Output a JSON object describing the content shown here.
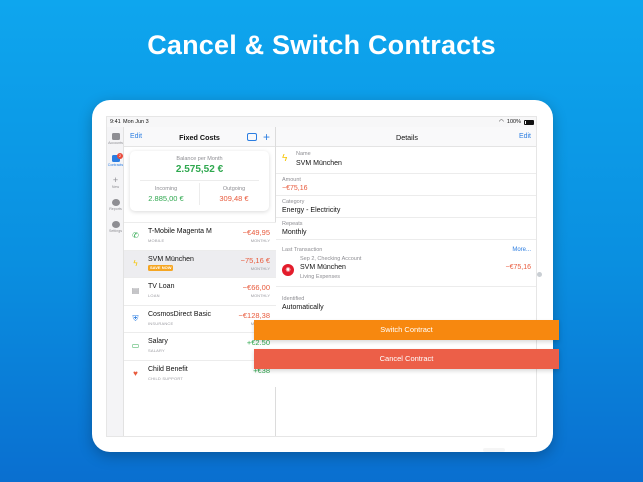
{
  "headline": "Cancel & Switch Contracts",
  "status_bar": {
    "time": "9:41",
    "date": "Mon Jun 3",
    "battery": "100%"
  },
  "rail": {
    "items": [
      {
        "label": "Accounts",
        "icon": "card-icon"
      },
      {
        "label": "Contracts",
        "icon": "contracts-icon",
        "badge": "2"
      },
      {
        "label": "New",
        "icon": "plus-icon"
      },
      {
        "label": "Reports",
        "icon": "pie-chart-icon"
      },
      {
        "label": "Settings",
        "icon": "gear-icon"
      }
    ]
  },
  "master": {
    "edit_label": "Edit",
    "title": "Fixed Costs",
    "balance": {
      "label": "Balance per Month",
      "value": "2.575,52 €",
      "incoming_label": "Incoming",
      "incoming_value": "2.885,00 €",
      "outgoing_label": "Outgoing",
      "outgoing_value": "309,48 €"
    },
    "rows": [
      {
        "name": "T-Mobile Magenta M",
        "sub": "MOBILE",
        "amount": "−€49,95",
        "freq": "MONTHLY",
        "icon": "phone-icon",
        "sign": "neg"
      },
      {
        "name": "SVM München",
        "badge": "SAVE NOW",
        "amount": "−75,16 €",
        "freq": "MONTHLY",
        "icon": "bolt-icon",
        "sign": "neg"
      },
      {
        "name": "TV Loan",
        "sub": "LOAN",
        "amount": "−€66,00",
        "freq": "MONTHLY",
        "icon": "document-icon",
        "sign": "neg"
      },
      {
        "name": "CosmosDirect Basic",
        "sub": "INSURANCE",
        "amount": "−€128,38",
        "freq": "MONTHLY",
        "icon": "shield-icon",
        "sign": "neg"
      },
      {
        "name": "Salary",
        "sub": "SALARY",
        "amount": "+€2.50",
        "freq": "M",
        "icon": "money-icon",
        "sign": "pos"
      },
      {
        "name": "Child Benefit",
        "sub": "CHILD SUPPORT",
        "amount": "+€38",
        "freq": "",
        "icon": "heart-icon",
        "sign": "pos"
      }
    ]
  },
  "detail": {
    "title": "Details",
    "edit_label": "Edit",
    "name_label": "Name",
    "name_value": "SVM München",
    "amount_label": "Amount",
    "amount_value": "−€75,16",
    "category_label": "Category",
    "category_value": "Energy - Electricity",
    "repeats_label": "Repeats",
    "repeats_value": "Monthly",
    "last_tx_label": "Last Transaction",
    "more_label": "More...",
    "tx_date": "Sep 2, Checking Account",
    "tx_name": "SVM München",
    "tx_category": "Living Expenses",
    "tx_amount": "−€75,16",
    "identified_label": "Identified",
    "identified_value": "Automatically"
  },
  "buttons": {
    "switch": "Switch Contract",
    "cancel": "Cancel Contract"
  },
  "colors": {
    "accent": "#2b7de1",
    "positive": "#2fa84f",
    "negative": "#e85a3c",
    "switch": "#f7880f",
    "cancel": "#ec5f48"
  }
}
